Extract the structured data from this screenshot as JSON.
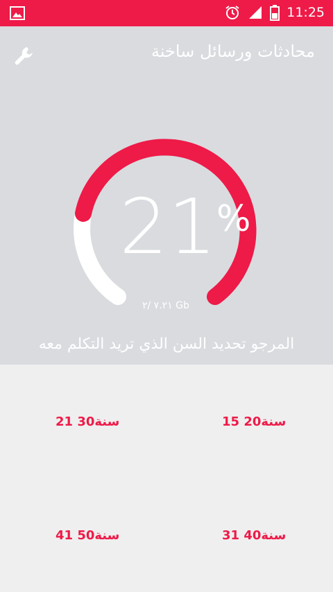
{
  "status_bar": {
    "time": "11:25",
    "accent": "#ee1a48"
  },
  "header": {
    "title": "محادثات ورسائل ساخنة"
  },
  "gauge": {
    "value": "21",
    "unit": "%",
    "caption": "۲/ ۷.۲۱ Gb",
    "fill_fraction": 0.21
  },
  "prompt": "المرجو تحديد السن الذي تريد التكلم معه",
  "age_options": [
    "15 20سنة",
    "21 30سنة",
    "31 40سنة",
    "41 50سنة"
  ],
  "icons": {
    "gallery": "image-icon",
    "alarm": "alarm-clock-icon",
    "signal": "signal-icon",
    "battery": "battery-icon",
    "settings": "wrench-icon"
  }
}
